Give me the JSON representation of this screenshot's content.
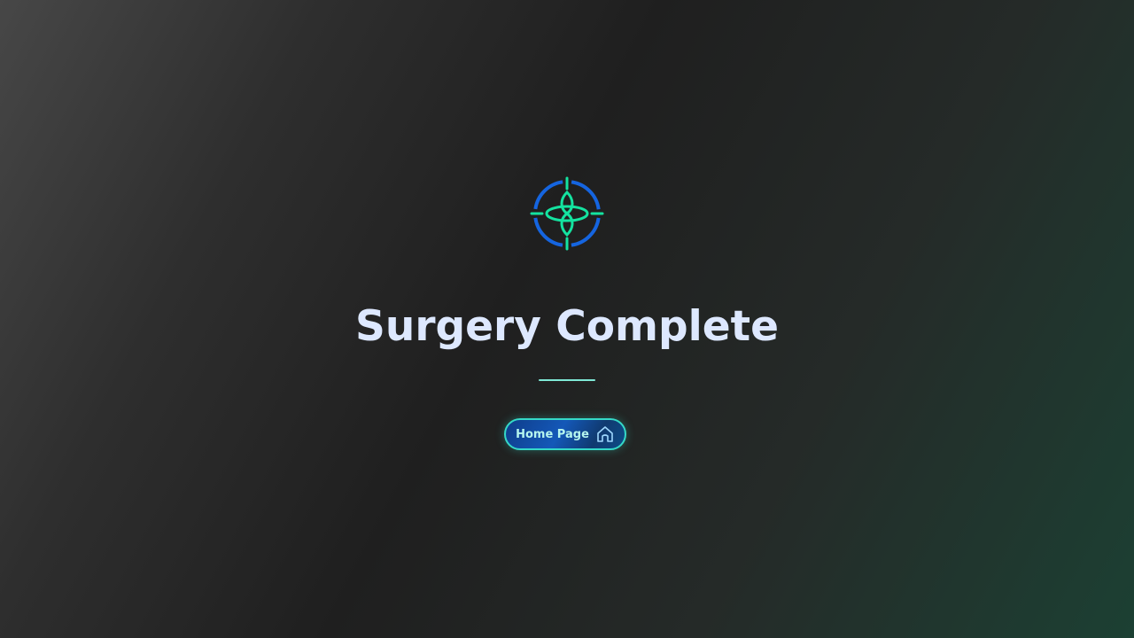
{
  "page": {
    "title": "Surgery Complete"
  },
  "logo": {
    "icon": "surgery-crosshair-icon"
  },
  "actions": {
    "home_label": "Home Page",
    "home_icon": "home-icon"
  },
  "colors": {
    "title": "#dde8ff",
    "accent_green": "#14e3a0",
    "accent_blue": "#1565e0",
    "divider": "#7fe8d6",
    "button_border": "#35d9c8",
    "button_text": "#b6f5ee"
  }
}
